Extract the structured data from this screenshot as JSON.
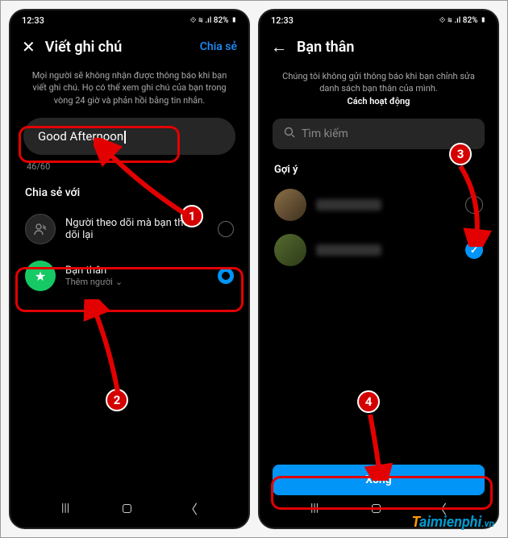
{
  "status": {
    "time": "12:33",
    "icons": "⟐ ⊘",
    "signal": "⟐ ≋ .ıl 82% ▮"
  },
  "left": {
    "header": {
      "title": "Viết ghi chú",
      "action": "Chia sẻ"
    },
    "subtext": "Mọi người sẽ không nhận được thông báo khi bạn viết ghi chú. Họ có thể xem ghi chú của bạn trong vòng 24 giờ và phản hồi bằng tin nhắn.",
    "note_value": "Good Afternoon",
    "counter": "46/60",
    "share_label": "Chia sẻ với",
    "followers": {
      "title": "Người theo dõi mà bạn theo dõi lại"
    },
    "close_friends": {
      "title": "Bạn thân",
      "sub": "Thêm người"
    }
  },
  "right": {
    "header": {
      "title": "Bạn thân"
    },
    "subtext_line1": "Chúng tôi không gửi thông báo khi bạn chỉnh sửa danh sách bạn thân của mình.",
    "subtext_bold": "Cách hoạt động",
    "search_placeholder": "Tìm kiếm",
    "suggest_label": "Gợi ý",
    "done_label": "Xong"
  },
  "steps": {
    "s1": "1",
    "s2": "2",
    "s3": "3",
    "s4": "4"
  },
  "watermark": {
    "t1": "T",
    "t2": "aimienphi",
    "vn": ".vn"
  }
}
